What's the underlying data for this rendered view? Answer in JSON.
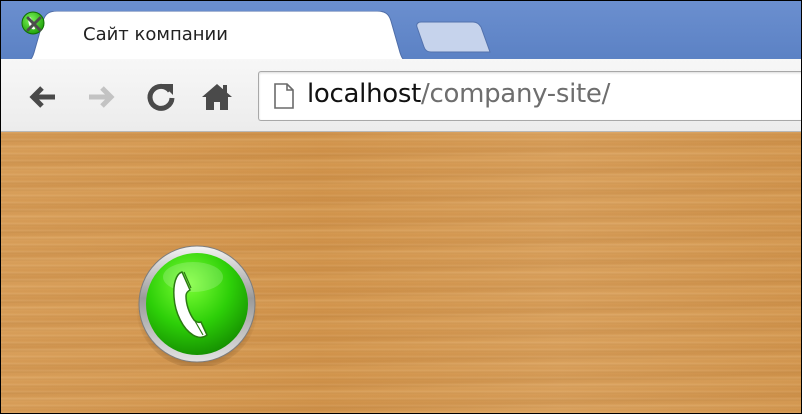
{
  "browser": {
    "tab": {
      "title": "Сайт компании",
      "favicon": "phone-favicon-icon",
      "close_symbol": "×"
    },
    "new_tab": "new-tab-icon",
    "toolbar": {
      "back": "back-arrow-icon",
      "forward": "forward-arrow-icon",
      "reload": "reload-icon",
      "home": "home-icon"
    },
    "address": {
      "host": "localhost",
      "path": "/company-site/"
    }
  },
  "page": {
    "background": "wood-texture",
    "call_button": "phone-handset-icon"
  },
  "colors": {
    "tabstrip": "#5b81c4",
    "call_green": "#2fd10a",
    "wood": "#d69a52"
  }
}
